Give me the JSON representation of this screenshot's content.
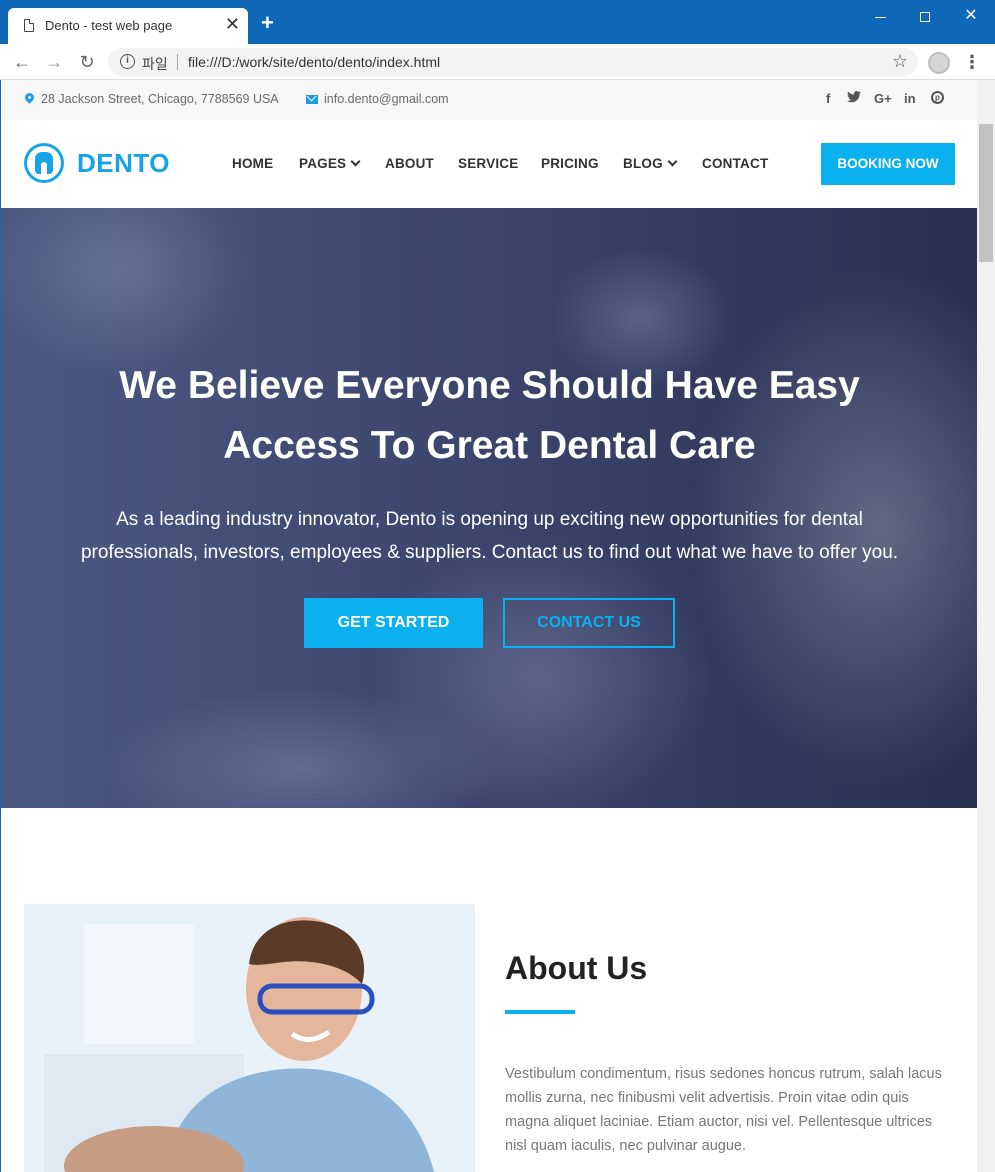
{
  "browser": {
    "tab_title": "Dento - test web page",
    "tab_close": "✕",
    "new_tab": "+",
    "omnibox_scheme": "파일",
    "url": "file:///D:/work/site/dento/dento/index.html",
    "window_close": "✕"
  },
  "topbar": {
    "address": "28 Jackson Street, Chicago, 7788569 USA",
    "email": "info.dento@gmail.com",
    "social": [
      "f",
      "t",
      "G+",
      "in",
      "p"
    ]
  },
  "header": {
    "logo": "DENTO",
    "nav": [
      {
        "label": "HOME"
      },
      {
        "label": "PAGES",
        "dropdown": true
      },
      {
        "label": "ABOUT"
      },
      {
        "label": "SERVICE"
      },
      {
        "label": "PRICING"
      },
      {
        "label": "BLOG",
        "dropdown": true
      },
      {
        "label": "CONTACT"
      }
    ],
    "cta": "BOOKING NOW"
  },
  "hero": {
    "title_line1": "We Believe Everyone Should Have Easy",
    "title_line2": "Access To Great Dental Care",
    "subtitle_line1": "As a leading industry innovator, Dento is opening up exciting new opportunities for dental",
    "subtitle_line2": "professionals, investors, employees & suppliers. Contact us to find out what we have to offer you.",
    "primary_button": "GET STARTED",
    "secondary_button": "CONTACT US"
  },
  "about": {
    "title": "About Us",
    "text": "Vestibulum condimentum, risus sedones honcus rutrum, salah lacus mollis zurna, nec finibusmi velit advertisis. Proin vitae odin quis magna aliquet laciniae. Etiam auctor, nisi vel. Pellentesque ultrices nisl quam iaculis, nec pulvinar augue."
  },
  "colors": {
    "accent": "#0bb0ef",
    "chrome": "#0f67b8",
    "hero_overlay": "#2e365f"
  }
}
